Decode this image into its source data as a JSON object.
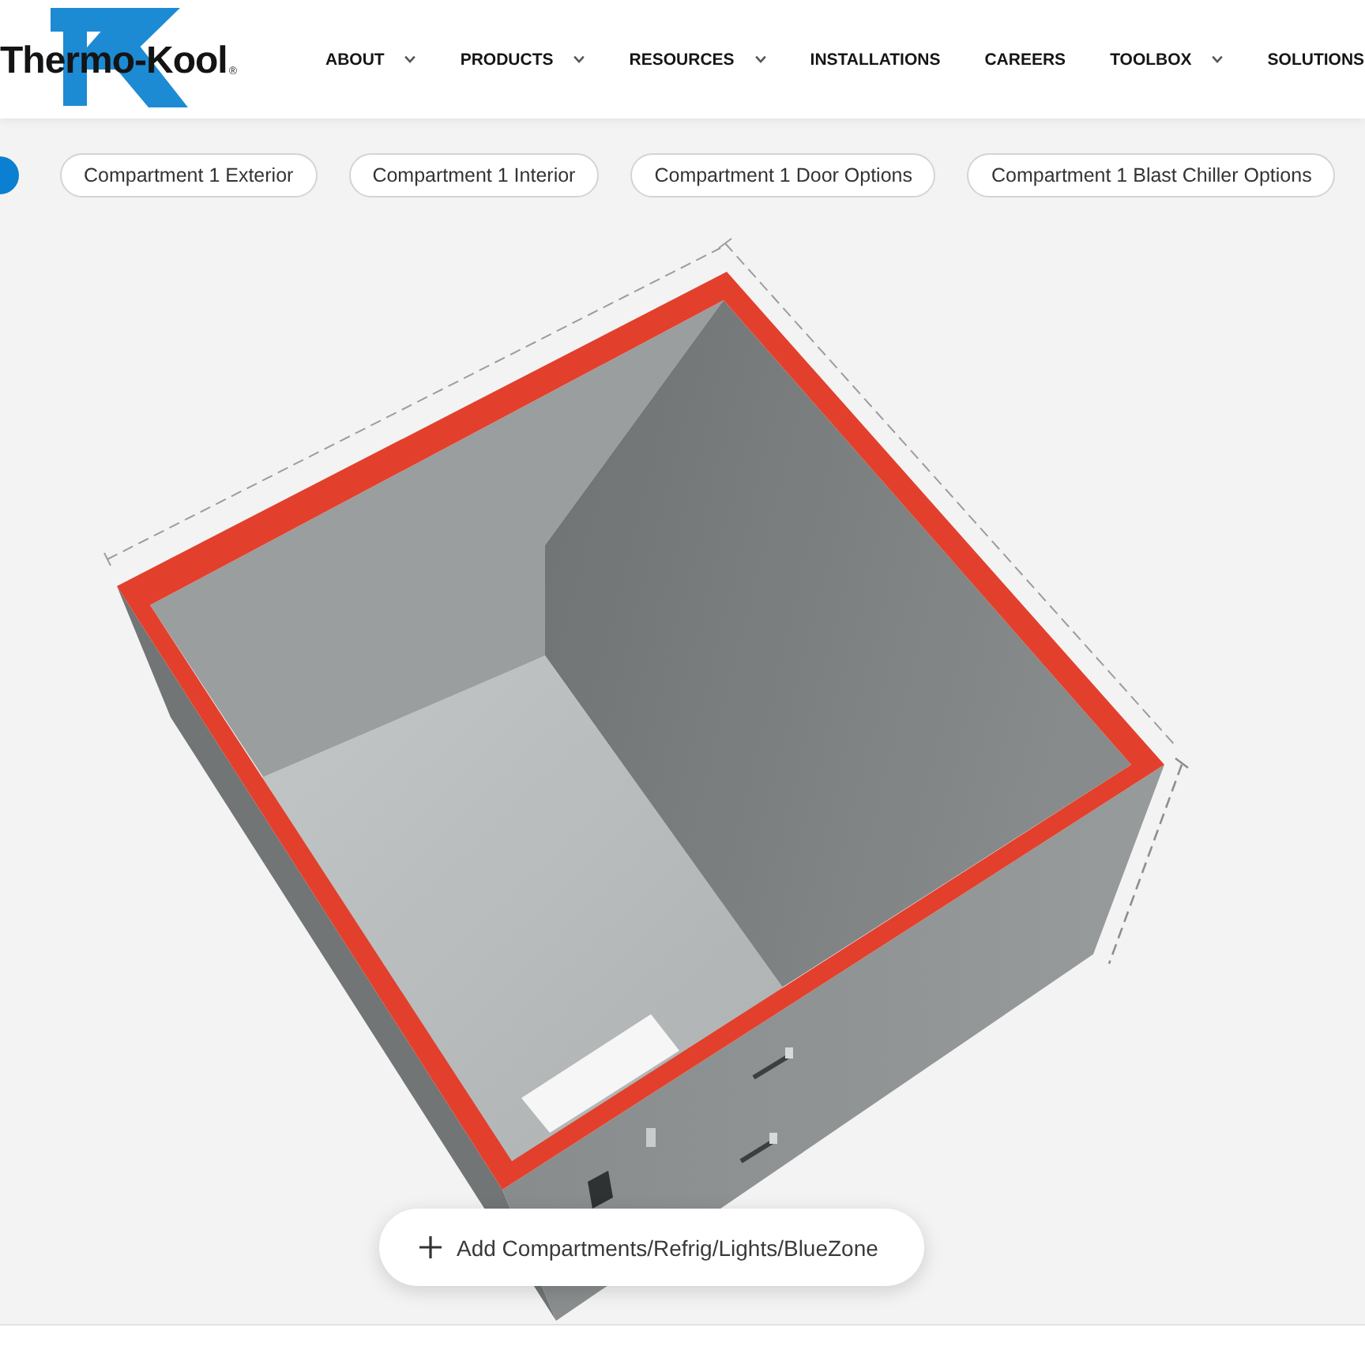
{
  "header": {
    "logo": {
      "wordmark": "Thermo-Kool",
      "trademark": "®"
    },
    "nav": [
      {
        "label": "ABOUT",
        "has_dropdown": true
      },
      {
        "label": "PRODUCTS",
        "has_dropdown": true
      },
      {
        "label": "RESOURCES",
        "has_dropdown": true
      },
      {
        "label": "INSTALLATIONS",
        "has_dropdown": false
      },
      {
        "label": "CAREERS",
        "has_dropdown": false
      },
      {
        "label": "TOOLBOX",
        "has_dropdown": true
      },
      {
        "label": "SOLUTIONS",
        "has_dropdown": false
      }
    ]
  },
  "tabs": [
    {
      "label": "Compartment 1 Exterior",
      "selected": false
    },
    {
      "label": "Compartment 1 Interior",
      "selected": false
    },
    {
      "label": "Compartment 1 Door Options",
      "selected": false
    },
    {
      "label": "Compartment 1 Blast Chiller Options",
      "selected": false
    }
  ],
  "viewer": {
    "add_button": {
      "label": "Add Compartments/Refrig/Lights/BlueZone"
    }
  }
}
